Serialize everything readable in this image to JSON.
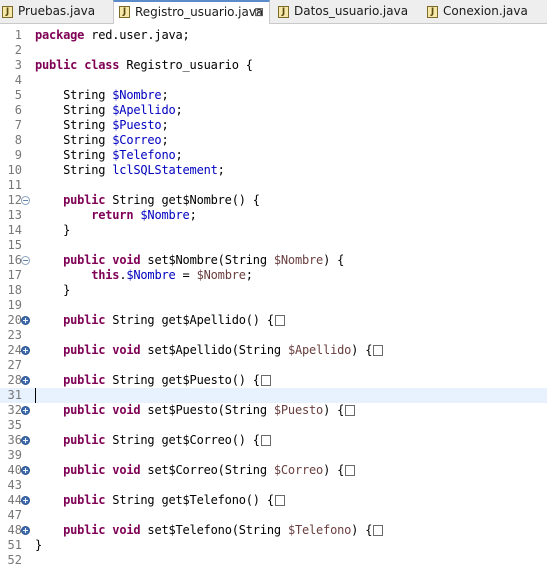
{
  "tabs": [
    {
      "label": "Pruebas.java",
      "icon": "java-file-icon",
      "active": false
    },
    {
      "label": "Registro_usuario.java",
      "icon": "java-file-icon",
      "active": true,
      "close": "⊠"
    },
    {
      "label": "Datos_usuario.java",
      "icon": "java-file-icon",
      "active": false
    },
    {
      "label": "Conexion.java",
      "icon": "java-file-icon",
      "active": false
    }
  ],
  "editor": {
    "current_line": 31,
    "lines": [
      {
        "n": "1",
        "segs": [
          {
            "t": "package",
            "k": "kw"
          },
          {
            "t": " red.user.java;"
          }
        ]
      },
      {
        "n": "2",
        "segs": []
      },
      {
        "n": "3",
        "segs": [
          {
            "t": "public",
            "k": "kw"
          },
          {
            "t": " "
          },
          {
            "t": "class",
            "k": "kw"
          },
          {
            "t": " Registro_usuario {"
          }
        ]
      },
      {
        "n": "4",
        "segs": []
      },
      {
        "n": "5",
        "segs": [
          {
            "t": "    String "
          },
          {
            "t": "$Nombre",
            "k": "fld"
          },
          {
            "t": ";"
          }
        ]
      },
      {
        "n": "6",
        "segs": [
          {
            "t": "    String "
          },
          {
            "t": "$Apellido",
            "k": "fld"
          },
          {
            "t": ";"
          }
        ]
      },
      {
        "n": "7",
        "segs": [
          {
            "t": "    String "
          },
          {
            "t": "$Puesto",
            "k": "fld"
          },
          {
            "t": ";"
          }
        ]
      },
      {
        "n": "8",
        "segs": [
          {
            "t": "    String "
          },
          {
            "t": "$Correo",
            "k": "fld"
          },
          {
            "t": ";"
          }
        ]
      },
      {
        "n": "9",
        "segs": [
          {
            "t": "    String "
          },
          {
            "t": "$Telefono",
            "k": "fld"
          },
          {
            "t": ";"
          }
        ]
      },
      {
        "n": "10",
        "segs": [
          {
            "t": "    String "
          },
          {
            "t": "lclSQLStatement",
            "k": "fld"
          },
          {
            "t": ";"
          }
        ]
      },
      {
        "n": "11",
        "segs": []
      },
      {
        "n": "12",
        "fold": "minus",
        "segs": [
          {
            "t": "    "
          },
          {
            "t": "public",
            "k": "kw"
          },
          {
            "t": " String get$Nombre() {"
          }
        ]
      },
      {
        "n": "13",
        "segs": [
          {
            "t": "        "
          },
          {
            "t": "return",
            "k": "kw"
          },
          {
            "t": " "
          },
          {
            "t": "$Nombre",
            "k": "fld"
          },
          {
            "t": ";"
          }
        ]
      },
      {
        "n": "14",
        "segs": [
          {
            "t": "    }"
          }
        ]
      },
      {
        "n": "15",
        "segs": []
      },
      {
        "n": "16",
        "fold": "minus",
        "segs": [
          {
            "t": "    "
          },
          {
            "t": "public",
            "k": "kw"
          },
          {
            "t": " "
          },
          {
            "t": "void",
            "k": "kw"
          },
          {
            "t": " set$Nombre(String "
          },
          {
            "t": "$Nombre",
            "k": "prm"
          },
          {
            "t": ") {"
          }
        ]
      },
      {
        "n": "17",
        "segs": [
          {
            "t": "        "
          },
          {
            "t": "this",
            "k": "kw"
          },
          {
            "t": "."
          },
          {
            "t": "$Nombre",
            "k": "fld"
          },
          {
            "t": " = "
          },
          {
            "t": "$Nombre",
            "k": "prm"
          },
          {
            "t": ";"
          }
        ]
      },
      {
        "n": "18",
        "segs": [
          {
            "t": "    }"
          }
        ]
      },
      {
        "n": "19",
        "segs": []
      },
      {
        "n": "20",
        "fold": "plus",
        "segs": [
          {
            "t": "    "
          },
          {
            "t": "public",
            "k": "kw"
          },
          {
            "t": " String get$Apellido() {"
          },
          {
            "box": true
          }
        ]
      },
      {
        "n": "23",
        "segs": []
      },
      {
        "n": "24",
        "fold": "plus",
        "segs": [
          {
            "t": "    "
          },
          {
            "t": "public",
            "k": "kw"
          },
          {
            "t": " "
          },
          {
            "t": "void",
            "k": "kw"
          },
          {
            "t": " set$Apellido(String "
          },
          {
            "t": "$Apellido",
            "k": "prm"
          },
          {
            "t": ") {"
          },
          {
            "box": true
          }
        ]
      },
      {
        "n": "27",
        "segs": []
      },
      {
        "n": "28",
        "fold": "plus",
        "segs": [
          {
            "t": "    "
          },
          {
            "t": "public",
            "k": "kw"
          },
          {
            "t": " String get$Puesto() {"
          },
          {
            "box": true
          }
        ]
      },
      {
        "n": "31",
        "segs": [],
        "caret": true
      },
      {
        "n": "32",
        "fold": "plus",
        "segs": [
          {
            "t": "    "
          },
          {
            "t": "public",
            "k": "kw"
          },
          {
            "t": " "
          },
          {
            "t": "void",
            "k": "kw"
          },
          {
            "t": " set$Puesto(String "
          },
          {
            "t": "$Puesto",
            "k": "prm"
          },
          {
            "t": ") {"
          },
          {
            "box": true
          }
        ]
      },
      {
        "n": "35",
        "segs": []
      },
      {
        "n": "36",
        "fold": "plus",
        "segs": [
          {
            "t": "    "
          },
          {
            "t": "public",
            "k": "kw"
          },
          {
            "t": " String get$Correo() {"
          },
          {
            "box": true
          }
        ]
      },
      {
        "n": "39",
        "segs": []
      },
      {
        "n": "40",
        "fold": "plus",
        "segs": [
          {
            "t": "    "
          },
          {
            "t": "public",
            "k": "kw"
          },
          {
            "t": " "
          },
          {
            "t": "void",
            "k": "kw"
          },
          {
            "t": " set$Correo(String "
          },
          {
            "t": "$Correo",
            "k": "prm"
          },
          {
            "t": ") {"
          },
          {
            "box": true
          }
        ]
      },
      {
        "n": "43",
        "segs": []
      },
      {
        "n": "44",
        "fold": "plus",
        "segs": [
          {
            "t": "    "
          },
          {
            "t": "public",
            "k": "kw"
          },
          {
            "t": " String get$Telefono() {"
          },
          {
            "box": true
          }
        ]
      },
      {
        "n": "47",
        "segs": []
      },
      {
        "n": "48",
        "fold": "plus",
        "segs": [
          {
            "t": "    "
          },
          {
            "t": "public",
            "k": "kw"
          },
          {
            "t": " "
          },
          {
            "t": "void",
            "k": "kw"
          },
          {
            "t": " set$Telefono(String "
          },
          {
            "t": "$Telefono",
            "k": "prm"
          },
          {
            "t": ") {"
          },
          {
            "box": true
          }
        ]
      },
      {
        "n": "51",
        "segs": [
          {
            "t": "}"
          }
        ]
      },
      {
        "n": "52",
        "segs": []
      }
    ]
  }
}
